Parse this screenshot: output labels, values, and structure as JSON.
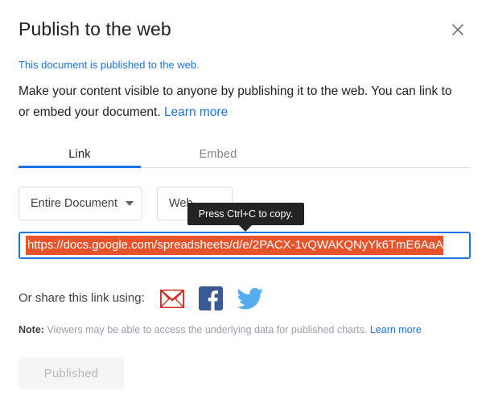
{
  "dialog": {
    "title": "Publish to the web",
    "close_icon": "close-icon"
  },
  "status": {
    "message": "This document is published to the web.",
    "color": "#1a73e8"
  },
  "description": {
    "text": "Make your content visible to anyone by publishing it to the web. You can link to or embed your document.",
    "learn_more": "Learn more"
  },
  "tabs": {
    "items": [
      {
        "label": "Link",
        "active": true
      },
      {
        "label": "Embed",
        "active": false
      }
    ],
    "active_color": "#1a73e8"
  },
  "selects": {
    "scope": {
      "value": "Entire Document",
      "caret_icon": "chevron-down-icon"
    },
    "format": {
      "value": "Web"
    }
  },
  "tooltip": {
    "text": "Press Ctrl+C to copy.",
    "background": "#232323"
  },
  "url_field": {
    "value": "https://docs.google.com/spreadsheets/d/e/2PACX-1vQWAKQNyYk6TmE6AaA",
    "selection_color": "#e8532b",
    "focus_border_color": "#1a73e8"
  },
  "share": {
    "label": "Or share this link using:",
    "icons": [
      {
        "name": "gmail-icon",
        "color": "#d93025"
      },
      {
        "name": "facebook-icon",
        "color": "#3b5998"
      },
      {
        "name": "twitter-icon",
        "color": "#55acee"
      }
    ]
  },
  "note": {
    "prefix": "Note:",
    "text": "Viewers may be able to access the underlying data for published charts.",
    "learn_more": "Learn more"
  },
  "footer": {
    "publish_button": "Published"
  }
}
